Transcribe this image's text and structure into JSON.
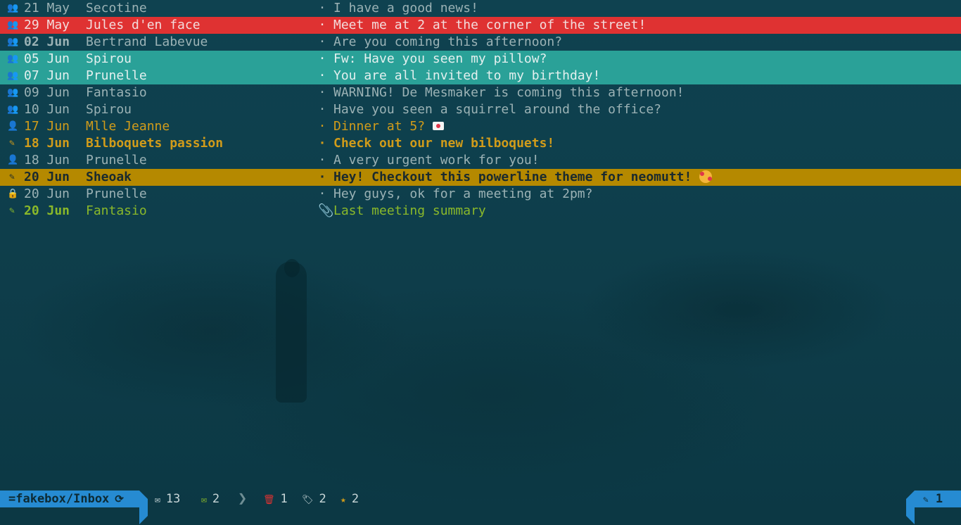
{
  "colors": {
    "background": "#0e3d49",
    "read_text": "#9bb2b5",
    "flagged": "#d19c1a",
    "new": "#8ab82a",
    "selected_red": "#df3232",
    "tagged_cyan": "#2aa198",
    "highlight_amber": "#b58900",
    "status_blue": "#268bd2"
  },
  "messages": [
    {
      "icon": "group-icon",
      "icon_glyph": "👥",
      "date": "21 May",
      "from": "Secotine",
      "sep": "·",
      "subject": "I have a good news!"
    },
    {
      "icon": "group-icon",
      "icon_glyph": "👥",
      "date": "29 May",
      "from": "Jules d'en face",
      "sep": "·",
      "subject": "Meet me at 2 at the corner of the street!"
    },
    {
      "icon": "group-icon",
      "icon_glyph": "👥",
      "date_day": "02",
      "date_month": "Jun",
      "from": "Bertrand Labevue",
      "sep": "·",
      "subject": "Are you coming this afternoon?"
    },
    {
      "icon": "group-icon",
      "icon_glyph": "👥",
      "date": "05 Jun",
      "from": "Spirou",
      "sep": "·",
      "subject": "Fw: Have you seen my pillow?"
    },
    {
      "icon": "group-icon",
      "icon_glyph": "👥",
      "date": "07 Jun",
      "from": "Prunelle",
      "sep": "·",
      "subject": "You are all invited to my birthday!"
    },
    {
      "icon": "group-icon",
      "icon_glyph": "👥",
      "date": "09 Jun",
      "from": "Fantasio",
      "sep": "·",
      "subject": "WARNING! De Mesmaker is coming this afternoon!"
    },
    {
      "icon": "group-icon",
      "icon_glyph": "👥",
      "date": "10 Jun",
      "from": "Spirou",
      "sep": "·",
      "subject": "Have you seen a squirrel around the office?"
    },
    {
      "icon": "user-icon",
      "icon_glyph": "👤",
      "date": "17 Jun",
      "from": "Mlle Jeanne",
      "sep": "·",
      "subject": "Dinner at 5?"
    },
    {
      "icon": "user-edit-icon",
      "icon_glyph": "✎",
      "date": "18 Jun",
      "from": "Bilboquets passion",
      "sep": "·",
      "subject": "Check out our new bilboquets!"
    },
    {
      "icon": "user-icon",
      "icon_glyph": "👤",
      "date": "18 Jun",
      "from": "Prunelle",
      "sep": "·",
      "subject": "A very urgent work for you!"
    },
    {
      "icon": "user-edit-icon",
      "icon_glyph": "✎",
      "date": "20 Jun",
      "from": "Sheoak",
      "sep": "·",
      "subject": "Hey! Checkout this powerline theme for neomutt!"
    },
    {
      "icon": "lock-icon",
      "icon_glyph": "🔒",
      "date": "20 Jun",
      "from": "Prunelle",
      "sep": "·",
      "subject": "Hey guys, ok for a meeting at 2pm?"
    },
    {
      "icon": "user-edit-icon",
      "icon_glyph": "✎",
      "date": "20 Jun",
      "from": "Fantasio",
      "sep": "📎",
      "subject": "Last meeting summary"
    }
  ],
  "status": {
    "mailbox": "=fakebox/Inbox",
    "sync_glyph": "⟳",
    "total_glyph": "✉",
    "total": "13",
    "new_glyph": "✉",
    "new": "2",
    "chevron": "❯",
    "deleted_glyph": "🗑",
    "deleted": "1",
    "tagged_glyph": "🏷",
    "tagged": "2",
    "flagged_glyph": "★",
    "flagged": "2",
    "edit_glyph": "✎",
    "edit_count": "1"
  }
}
